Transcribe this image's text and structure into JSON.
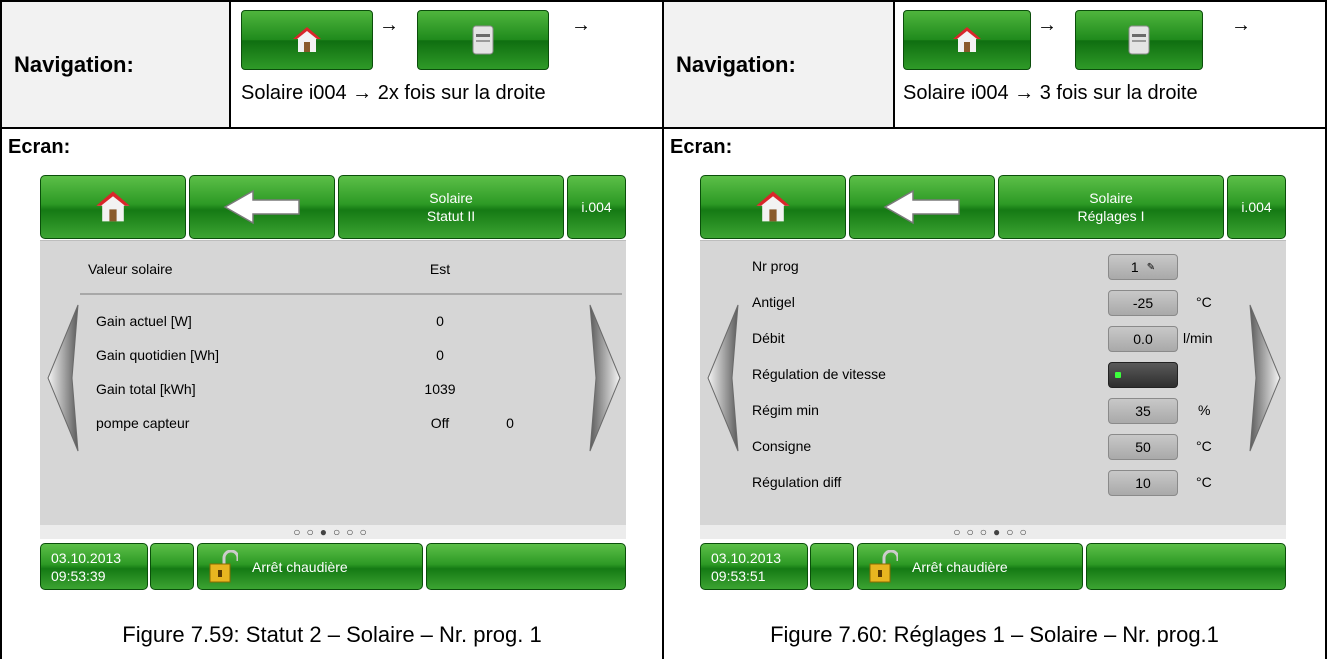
{
  "left": {
    "nav_label": "Navigation:",
    "nav_path": "Solaire i004 → 2x fois sur la droite",
    "ecran_label": "Ecran:",
    "screen": {
      "title_line1": "Solaire",
      "title_line2": "Statut II",
      "code": "i.004",
      "rows": [
        {
          "label": "Valeur solaire",
          "value": "Est",
          "extra": ""
        },
        {
          "label": "Gain actuel [W]",
          "value": "0",
          "extra": ""
        },
        {
          "label": "Gain quotidien [Wh]",
          "value": "0",
          "extra": ""
        },
        {
          "label": "Gain total [kWh]",
          "value": "1039",
          "extra": ""
        },
        {
          "label": "pompe capteur",
          "value": "Off",
          "extra": "0"
        }
      ],
      "pager": "○○●○○○",
      "date": "03.10.2013",
      "time": "09:53:39",
      "status": "Arrêt chaudière"
    },
    "caption": "Figure 7.59: Statut 2 – Solaire – Nr. prog. 1"
  },
  "right": {
    "nav_label": "Navigation:",
    "nav_path": "Solaire i004 → 3 fois sur la droite",
    "ecran_label": "Ecran:",
    "screen": {
      "title_line1": "Solaire",
      "title_line2": "Réglages I",
      "code": "i.004",
      "rows": [
        {
          "label": "Nr prog",
          "value": "1",
          "unit": ""
        },
        {
          "label": "Antigel",
          "value": "-25",
          "unit": "°C"
        },
        {
          "label": "Débit",
          "value": "0.0",
          "unit": "l/min"
        },
        {
          "label": "Régulation de vitesse",
          "value": "",
          "unit": ""
        },
        {
          "label": "Régim min",
          "value": "35",
          "unit": "%"
        },
        {
          "label": "Consigne",
          "value": "50",
          "unit": "°C"
        },
        {
          "label": "Régulation diff",
          "value": "10",
          "unit": "°C"
        }
      ],
      "pager": "○○○●○○",
      "date": "03.10.2013",
      "time": "09:53:51",
      "status": "Arrêt chaudière"
    },
    "caption": "Figure 7.60: Réglages 1 – Solaire – Nr. prog.1"
  },
  "arrow_glyph": "→",
  "colors": {
    "button_green": "#2d9a25",
    "panel_grey": "#d6d6d6",
    "field_grey": "#b5b5b5"
  }
}
